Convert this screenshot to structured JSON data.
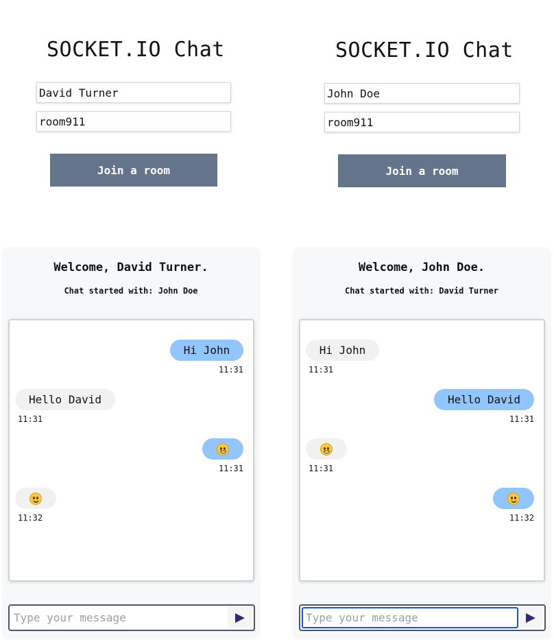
{
  "left": {
    "title": "SOCKET.IO Chat",
    "username_value": "David Turner",
    "room_value": "room911",
    "join_label": "Join a room",
    "welcome": "Welcome, David Turner.",
    "started_with": "Chat started with: John Doe",
    "messages": [
      {
        "type": "sent",
        "text": "Hi John",
        "time": "11:31"
      },
      {
        "type": "recv",
        "text": "Hello David",
        "time": "11:31"
      },
      {
        "type": "sent",
        "emoji": "grinning-face-emoji",
        "time": "11:31"
      },
      {
        "type": "recv",
        "emoji": "slightly-smiling-face-emoji",
        "time": "11:32"
      }
    ],
    "message_placeholder": "Type your message"
  },
  "right": {
    "title": "SOCKET.IO Chat",
    "username_value": "John Doe",
    "room_value": "room911",
    "join_label": "Join a room",
    "welcome": "Welcome, John Doe.",
    "started_with": "Chat started with: David Turner",
    "messages": [
      {
        "type": "recv",
        "text": "Hi John",
        "time": "11:31"
      },
      {
        "type": "sent",
        "text": "Hello David",
        "time": "11:31"
      },
      {
        "type": "recv",
        "emoji": "grinning-face-emoji",
        "time": "11:31"
      },
      {
        "type": "sent",
        "emoji": "slightly-smiling-face-emoji",
        "time": "11:32"
      }
    ],
    "message_placeholder": "Type your message"
  },
  "icons": {
    "send": "send-arrow-icon"
  },
  "colors": {
    "sent_bubble": "#93c5fd",
    "received_bubble": "#f1f1f2",
    "join_button": "#64748b",
    "send_icon": "#2f2b70",
    "focused_border": "#1d4ed8"
  }
}
